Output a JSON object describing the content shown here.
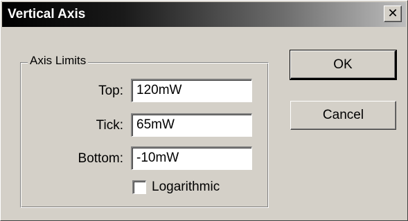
{
  "window": {
    "title": "Vertical Axis",
    "close_glyph": "✕"
  },
  "axis_limits": {
    "group_label": "Axis Limits",
    "top": {
      "label": "Top:",
      "value": "120mW"
    },
    "tick": {
      "label": "Tick:",
      "value": "65mW"
    },
    "bottom": {
      "label": "Bottom:",
      "value": "-10mW"
    },
    "logarithmic": {
      "label": "Logarithmic",
      "checked": false
    }
  },
  "buttons": {
    "ok": "OK",
    "cancel": "Cancel"
  },
  "colors": {
    "face": "#d4d0c8",
    "title_start": "#000000",
    "title_end": "#bdbdbd"
  }
}
